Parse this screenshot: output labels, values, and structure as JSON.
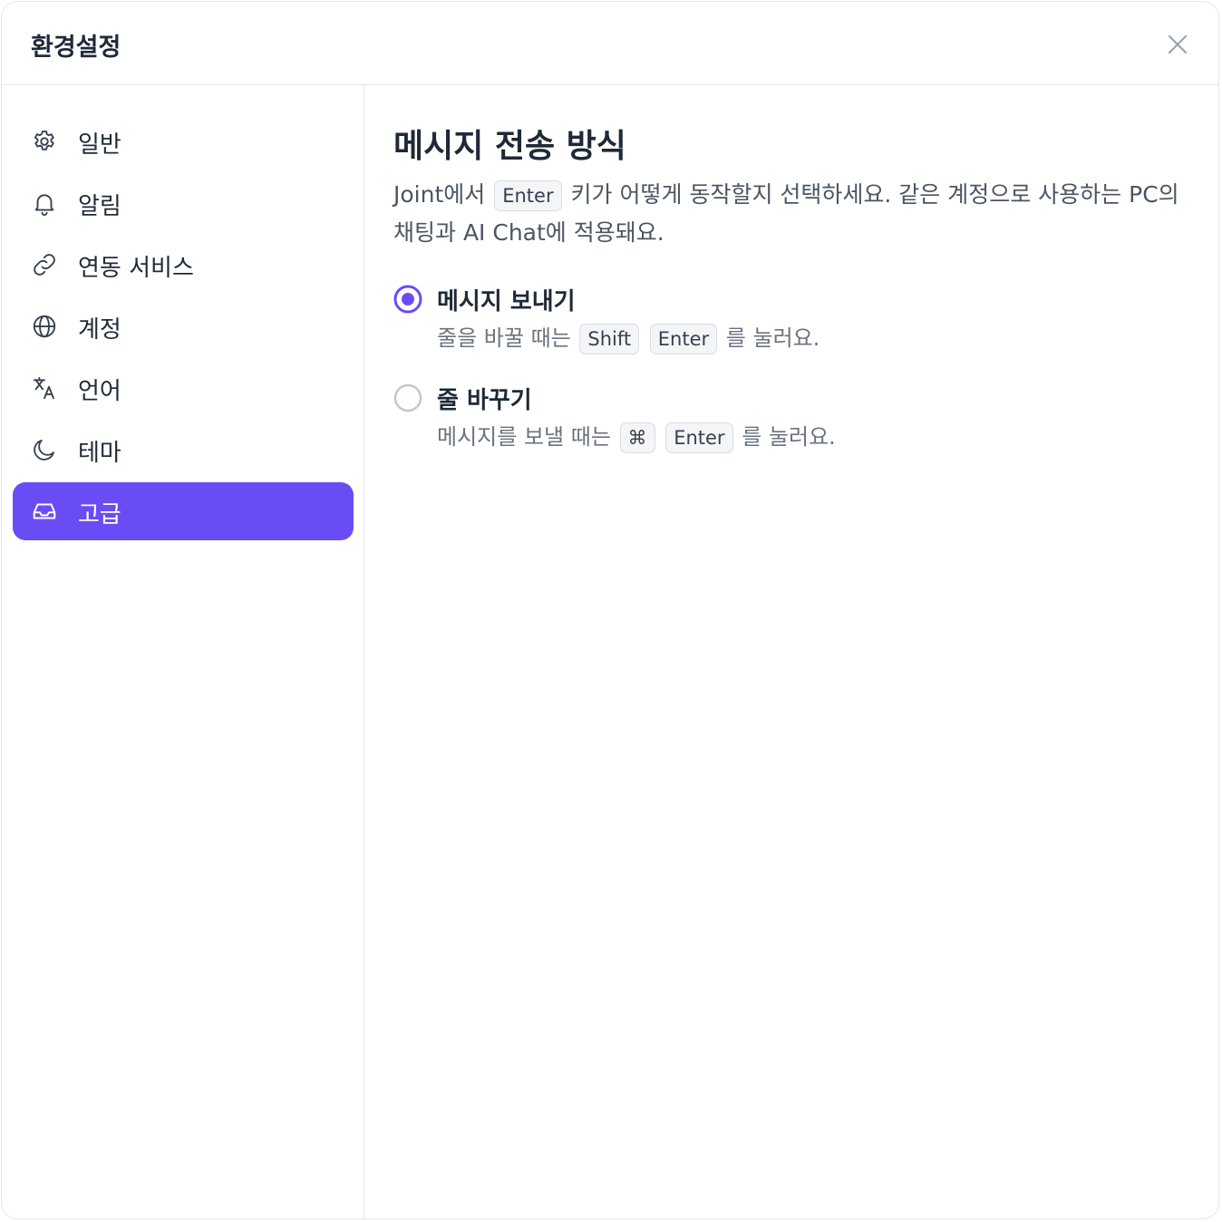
{
  "dialog": {
    "title": "환경설정",
    "close_icon": "close-icon"
  },
  "sidebar": {
    "items": [
      {
        "label": "일반",
        "icon": "gear-icon"
      },
      {
        "label": "알림",
        "icon": "bell-icon"
      },
      {
        "label": "연동 서비스",
        "icon": "link-icon"
      },
      {
        "label": "계정",
        "icon": "globe-icon"
      },
      {
        "label": "언어",
        "icon": "translate-icon"
      },
      {
        "label": "테마",
        "icon": "moon-icon"
      },
      {
        "label": "고급",
        "icon": "inbox-icon",
        "active": true
      }
    ],
    "active_color": "#6a4cf5"
  },
  "section": {
    "title": "메시지 전송 방식",
    "desc_before": "Joint에서",
    "desc_key": "Enter",
    "desc_after": "키가 어떻게 동작할지 선택하세요. 같은 계정으로 사용하는 PC의 채팅과 AI Chat에 적용돼요."
  },
  "options": [
    {
      "title": "메시지 보내기",
      "selected": true,
      "sub_before": "줄을 바꿀 때는",
      "keys": [
        "Shift",
        "Enter"
      ],
      "sub_after": "를 눌러요."
    },
    {
      "title": "줄 바꾸기",
      "selected": false,
      "sub_before": "메시지를 보낼 때는",
      "keys": [
        "⌘",
        "Enter"
      ],
      "sub_after": "를 눌러요."
    }
  ]
}
